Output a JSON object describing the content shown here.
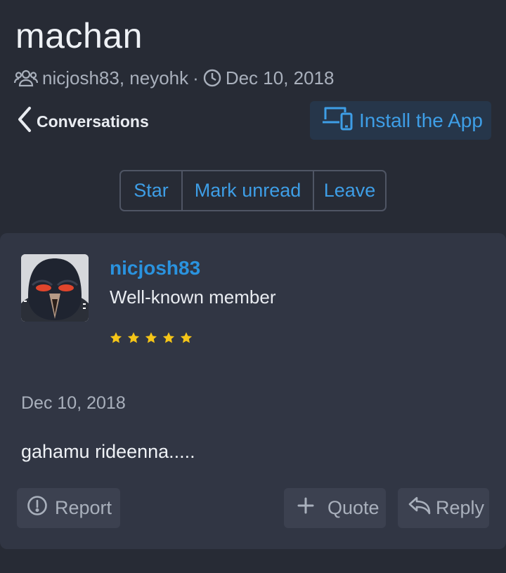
{
  "header": {
    "title": "machan",
    "participants": "nicjosh83, neyohk",
    "separator": "·",
    "date": "Dec 10, 2018"
  },
  "nav": {
    "back_label": "Conversations",
    "install_label": "Install the App"
  },
  "actions": {
    "star": "Star",
    "mark_unread": "Mark unread",
    "leave": "Leave"
  },
  "message": {
    "username": "nicjosh83",
    "user_title": "Well-known member",
    "rating_stars": 5,
    "date": "Dec 10, 2018",
    "body": "gahamu rideenna.....",
    "buttons": {
      "report": "Report",
      "quote": "Quote",
      "reply": "Reply"
    }
  },
  "colors": {
    "background": "#272b35",
    "card": "#313644",
    "accent": "#2a93df",
    "star": "#f5c518"
  }
}
